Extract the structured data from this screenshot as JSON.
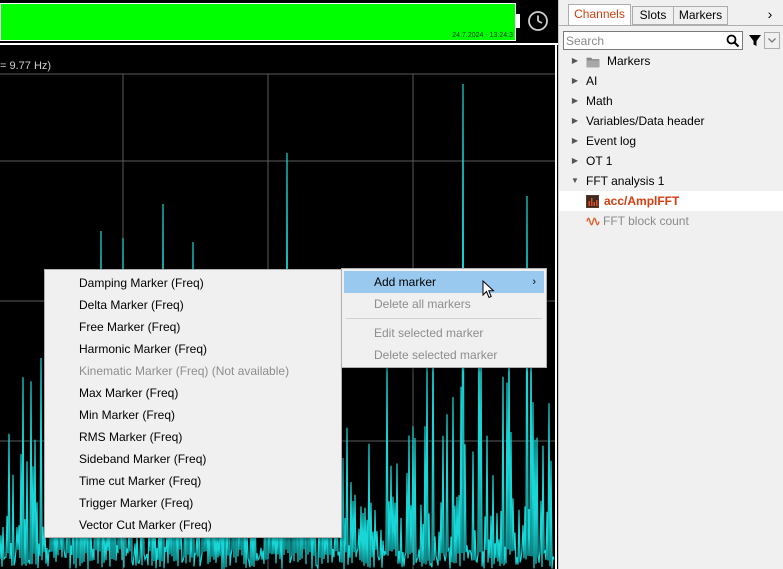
{
  "header": {
    "timestamp": "24.7.2024 - 13:24:3"
  },
  "plot": {
    "freq_label": "= 9.77 Hz)",
    "line_color": "#19d6d6",
    "grid_color": "#5a5a5a"
  },
  "tabs": [
    {
      "label": "Channels",
      "active": true
    },
    {
      "label": "Slots",
      "active": false
    },
    {
      "label": "Markers",
      "active": false
    }
  ],
  "search": {
    "placeholder": "Search"
  },
  "tree": [
    {
      "label": "Markers",
      "expanded": false,
      "icon": "folder-icon"
    },
    {
      "label": "AI",
      "expanded": false
    },
    {
      "label": "Math",
      "expanded": false
    },
    {
      "label": "Variables/Data header",
      "expanded": false
    },
    {
      "label": "Event log",
      "expanded": false
    },
    {
      "label": "OT 1",
      "expanded": false
    },
    {
      "label": "FFT analysis 1",
      "expanded": true
    },
    {
      "label": "acc/AmplFFT",
      "icon": "fft-channel-icon",
      "selected": true
    },
    {
      "label": "FFT block count",
      "icon": "waveform-icon",
      "dim": true
    }
  ],
  "context_menu": {
    "items": [
      {
        "label": "Add marker",
        "highlighted": true,
        "has_submenu": true
      },
      {
        "label": "Delete all markers",
        "disabled": true
      },
      {
        "label": "Edit selected marker",
        "disabled": true
      },
      {
        "label": "Delete selected marker",
        "disabled": true
      }
    ]
  },
  "submenu": {
    "items": [
      {
        "label": "Damping Marker (Freq)"
      },
      {
        "label": "Delta Marker (Freq)"
      },
      {
        "label": "Free Marker (Freq)"
      },
      {
        "label": "Harmonic Marker (Freq)"
      },
      {
        "label": "Kinematic Marker (Freq) (Not available)",
        "disabled": true
      },
      {
        "label": "Max Marker (Freq)"
      },
      {
        "label": "Min Marker (Freq)"
      },
      {
        "label": "RMS Marker (Freq)"
      },
      {
        "label": "Sideband Marker (Freq)"
      },
      {
        "label": "Time cut Marker (Freq)"
      },
      {
        "label": "Trigger Marker (Freq)"
      },
      {
        "label": "Vector Cut Marker (Freq)"
      }
    ]
  },
  "colors": {
    "accent": "#d04010",
    "status_bar": "#00ff00",
    "menu_highlight": "#99c9ef"
  }
}
